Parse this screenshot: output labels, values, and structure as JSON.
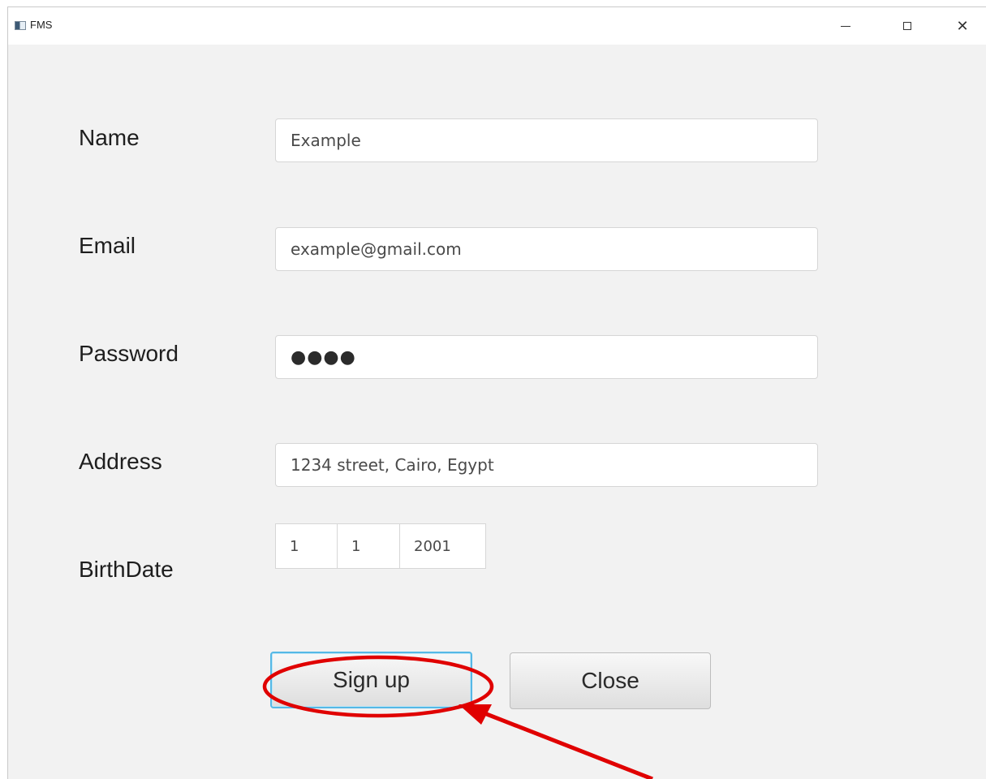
{
  "window": {
    "title": "FMS",
    "icon": "app-window-icon",
    "controls": {
      "minimize": "minimize-icon",
      "maximize": "maximize-icon",
      "close": "✕"
    }
  },
  "form": {
    "name": {
      "label": "Name",
      "value": "Example"
    },
    "email": {
      "label": "Email",
      "value": "example@gmail.com"
    },
    "password": {
      "label": "Password",
      "value": "●●●●"
    },
    "address": {
      "label": "Address",
      "value": "1234 street, Cairo, Egypt"
    },
    "birthdate": {
      "label": "BirthDate",
      "day": "1",
      "month": "1",
      "year": "2001"
    }
  },
  "buttons": {
    "signup": "Sign up",
    "close": "Close"
  },
  "annotation": {
    "highlight_color": "#e00000",
    "focus_color": "#55b8e6"
  }
}
